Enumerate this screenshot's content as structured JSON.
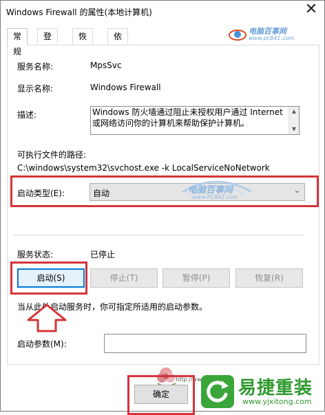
{
  "window": {
    "title": "Windows Firewall 的属性(本地计算机)",
    "close_glyph": "✕"
  },
  "tabs": [
    {
      "label": "常规",
      "active": true
    },
    {
      "label": "登录",
      "active": false
    },
    {
      "label": "恢复",
      "active": false
    },
    {
      "label": "依存关系",
      "active": false
    }
  ],
  "general": {
    "service_name_label": "服务名称:",
    "service_name_value": "MpsSvc",
    "display_name_label": "显示名称:",
    "display_name_value": "Windows Firewall",
    "description_label": "描述:",
    "description_value": "Windows 防火墙通过阻止未授权用户通过 Internet 或网络访问你的计算机来帮助保护计算机。",
    "exe_path_label": "可执行文件的路径:",
    "exe_path_value": "C:\\windows\\system32\\svchost.exe -k LocalServiceNoNetwork",
    "startup_type_label": "启动类型(E):",
    "startup_type_value": "自动",
    "service_status_label": "服务状态:",
    "service_status_value": "已停止",
    "buttons": {
      "start": "启动(S)",
      "stop": "停止(T)",
      "pause": "暂停(P)",
      "resume": "恢复(R)"
    },
    "hint_text": "当从此处启动服务时，你可指定所适用的启动参数。",
    "start_params_label": "启动参数(M):",
    "start_params_value": ""
  },
  "footer": {
    "ok_label": "确定"
  },
  "watermarks": {
    "top_logo": "电脑百事网",
    "top_logo_url": "www.pc841.com",
    "center_logo": "电脑百事网",
    "center_logo_url": "www.PC841.com",
    "brand_name": "易捷重装",
    "brand_url": "www.yjxitong.com",
    "flower_text": "http://www"
  },
  "colors": {
    "highlight_red": "#d4343a",
    "brand_green": "#2f9a2f",
    "focus_blue": "#0078d7"
  }
}
